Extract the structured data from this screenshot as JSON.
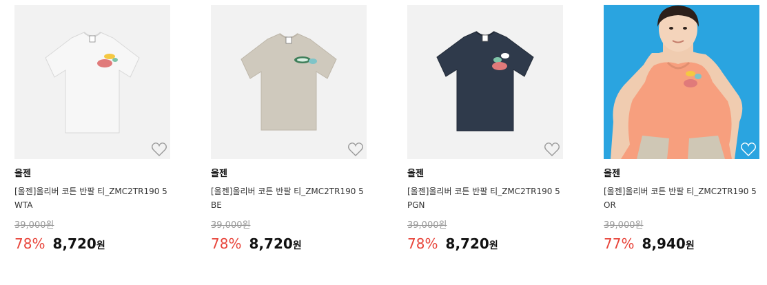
{
  "products": [
    {
      "brand": "올젠",
      "title": "[올젠]올리버 코튼 반팔 티_ZMC2TR190 5WTA",
      "original_price": "39,000원",
      "discount": "78%",
      "price": "8,720",
      "currency": "원",
      "image": {
        "kind": "flat-tshirt",
        "shirt_color": "#f7f7f7",
        "background": "#f2f2f2"
      },
      "wishlist_icon": "heart-outline-icon"
    },
    {
      "brand": "올젠",
      "title": "[올젠]올리버 코튼 반팔 티_ZMC2TR190 5BE",
      "original_price": "39,000원",
      "discount": "78%",
      "price": "8,720",
      "currency": "원",
      "image": {
        "kind": "flat-tshirt",
        "shirt_color": "#cfc9bd",
        "background": "#f2f2f2"
      },
      "wishlist_icon": "heart-outline-icon"
    },
    {
      "brand": "올젠",
      "title": "[올젠]올리버 코튼 반팔 티_ZMC2TR190 5PGN",
      "original_price": "39,000원",
      "discount": "78%",
      "price": "8,720",
      "currency": "원",
      "image": {
        "kind": "flat-tshirt",
        "shirt_color": "#2f3a4b",
        "background": "#f2f2f2"
      },
      "wishlist_icon": "heart-outline-icon"
    },
    {
      "brand": "올젠",
      "title": "[올젠]올리버 코튼 반팔 티_ZMC2TR190 5OR",
      "original_price": "39,000원",
      "discount": "77%",
      "price": "8,940",
      "currency": "원",
      "image": {
        "kind": "model-photo",
        "shirt_color": "#f79f7e",
        "background": "#2aa4e0"
      },
      "wishlist_icon": "heart-outline-icon"
    }
  ],
  "colors": {
    "discount": "#e8443a",
    "original_price": "#999999",
    "price": "#111111"
  }
}
